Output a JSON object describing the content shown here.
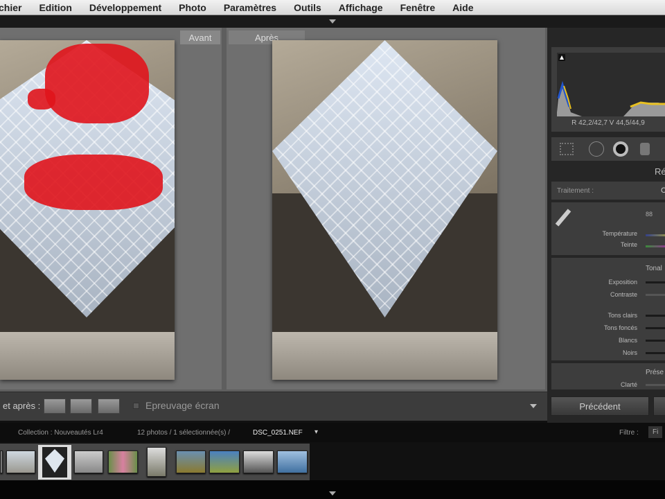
{
  "menu": {
    "items": [
      "chier",
      "Edition",
      "Développement",
      "Photo",
      "Paramètres",
      "Outils",
      "Affichage",
      "Fenêtre",
      "Aide"
    ]
  },
  "compare": {
    "before_label": "Avant",
    "after_label": "Après"
  },
  "histogram": {
    "readout": "R 42,2/42,7  V 44,5/44,9"
  },
  "panel": {
    "header_partial": "Ré",
    "treatment_label": "Traitement :",
    "treatment_value_partial": "C",
    "wb_partial": "88",
    "temperature_label": "Température",
    "tint_label": "Teinte",
    "tone_header_partial": "Tonal",
    "exposure_label": "Exposition",
    "contrast_label": "Contraste",
    "highlights_label": "Tons clairs",
    "shadows_label": "Tons foncés",
    "whites_label": "Blancs",
    "blacks_label": "Noirs",
    "presence_header_partial": "Prése",
    "clarity_label": "Clarté",
    "previous_button": "Précédent"
  },
  "toolbar": {
    "before_after_label": "et après :",
    "soft_proof_label": "Epreuvage écran"
  },
  "filmstrip": {
    "collection": "Collection : Nouveautés Lr4",
    "count": "12 photos / 1 sélectionnée(s) /",
    "filename": "DSC_0251.NEF",
    "filter_label": "Filtre :",
    "filter_value_partial": "Fi"
  },
  "colors": {
    "clipping": "#e0141c",
    "panel_bg": "#262626",
    "main_bg": "#5e5e5e"
  }
}
